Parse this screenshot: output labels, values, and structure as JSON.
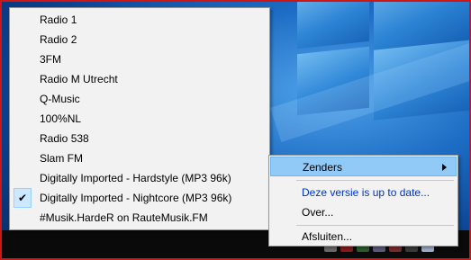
{
  "stations_menu": {
    "items": [
      {
        "label": "Radio 1",
        "checked": false
      },
      {
        "label": "Radio 2",
        "checked": false
      },
      {
        "label": "3FM",
        "checked": false
      },
      {
        "label": "Radio M Utrecht",
        "checked": false
      },
      {
        "label": "Q-Music",
        "checked": false
      },
      {
        "label": "100%NL",
        "checked": false
      },
      {
        "label": "Radio 538",
        "checked": false
      },
      {
        "label": "Slam FM",
        "checked": false
      },
      {
        "label": "Digitally Imported - Hardstyle (MP3 96k)",
        "checked": false
      },
      {
        "label": "Digitally Imported - Nightcore (MP3 96k)",
        "checked": true
      },
      {
        "label": "#Musik.HardeR on RauteMusik.FM",
        "checked": false
      }
    ],
    "check_glyph": "✔"
  },
  "tray_menu": {
    "zenders_label": "Zenders",
    "update_label": "Deze versie is up to date...",
    "about_label": "Over...",
    "exit_label": "Afsluiten..."
  },
  "colors": {
    "highlight": "#91c9f7",
    "link_blue": "#0033cc",
    "border_red": "#d11414"
  }
}
